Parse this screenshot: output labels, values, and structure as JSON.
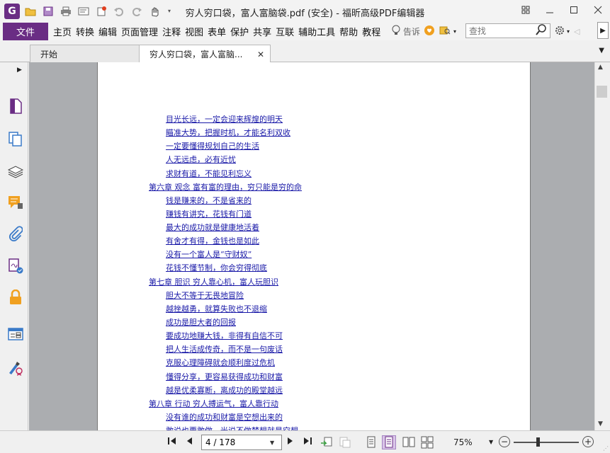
{
  "window": {
    "title": "穷人穷口袋，富人富脑袋.pdf (安全) - 福昕高级PDF编辑器",
    "logo_text": "G"
  },
  "menu": {
    "file": "文件",
    "items": [
      "主页",
      "转换",
      "编辑",
      "页面管理",
      "注释",
      "视图",
      "表单",
      "保护",
      "共享",
      "互联",
      "辅助工具",
      "帮助",
      "教程"
    ],
    "tell_me": "告诉",
    "search_placeholder": "查找"
  },
  "tabs": [
    {
      "label": "开始"
    },
    {
      "label": "穷人穷口袋，富人富脑..."
    }
  ],
  "sidebar": {
    "icons": [
      "page-thumbnail-icon",
      "copy-pages-icon",
      "layers-icon",
      "comments-icon",
      "attachments-icon",
      "signature-icon",
      "lock-icon",
      "form-fields-icon",
      "certificate-icon"
    ]
  },
  "document": {
    "lines": [
      {
        "kind": "sub",
        "text": "目光长远，一定会迎来辉煌的明天"
      },
      {
        "kind": "sub",
        "text": "瞄准大势，把握时机，才能名利双收"
      },
      {
        "kind": "sub",
        "text": "一定要懂得规划自己的生活"
      },
      {
        "kind": "sub",
        "text": "人无远虑，必有近忧"
      },
      {
        "kind": "sub",
        "text": "求财有道，不能见利忘义"
      },
      {
        "kind": "chap",
        "text": "第六章 观念 富有富的理由，穷只能是穷的命"
      },
      {
        "kind": "sub",
        "text": "钱是赚来的，不是省来的"
      },
      {
        "kind": "sub",
        "text": "赚钱有讲究，花钱有门道"
      },
      {
        "kind": "sub",
        "text": "最大的成功就是健康地活着"
      },
      {
        "kind": "sub",
        "text": "有舍才有得，金钱也是如此"
      },
      {
        "kind": "sub",
        "text": "没有一个富人是“守财奴”"
      },
      {
        "kind": "sub",
        "text": "花钱不懂节制，你会穷得彻底"
      },
      {
        "kind": "chap",
        "text": "第七章 胆识 穷人靠心机，富人玩胆识"
      },
      {
        "kind": "sub",
        "text": "胆大不等于无畏地冒险"
      },
      {
        "kind": "sub",
        "text": "越挫越勇，就算失败也不退缩"
      },
      {
        "kind": "sub",
        "text": "成功是胆大者的回报"
      },
      {
        "kind": "sub",
        "text": "要成功地赚大钱，非得有自信不可"
      },
      {
        "kind": "sub",
        "text": "把人生活成传奇，而不是一句废话"
      },
      {
        "kind": "sub",
        "text": "克服心理障碍就会顺利度过危机"
      },
      {
        "kind": "sub",
        "text": "懂得分享，更容易获得成功和财富"
      },
      {
        "kind": "sub",
        "text": "越是优柔寡断，离成功的殿堂越远"
      },
      {
        "kind": "chap",
        "text": "第八章 行动 穷人搏运气，富人靠行动"
      },
      {
        "kind": "sub",
        "text": "没有谁的成功和财富是空想出来的"
      },
      {
        "kind": "sub",
        "text": "敢说也要敢做，光说不做梦想就是空想"
      }
    ]
  },
  "status": {
    "page_field": "4 / 178",
    "zoom": "75%"
  }
}
